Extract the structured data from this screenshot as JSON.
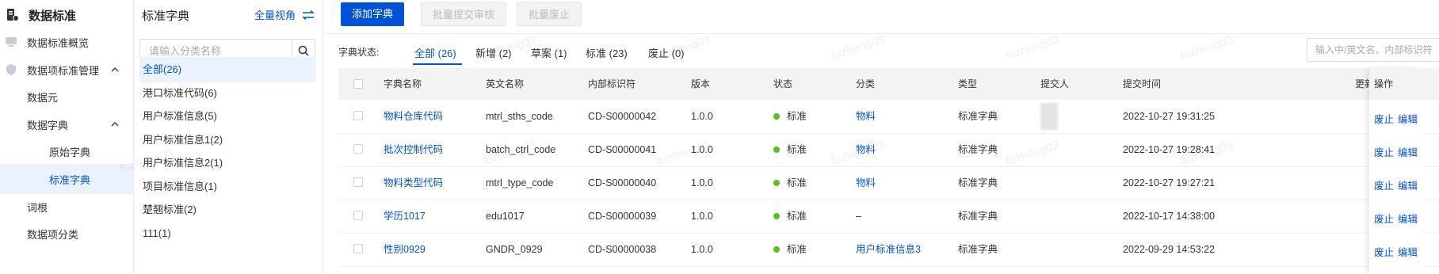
{
  "nav": {
    "title": "数据标准",
    "items": [
      {
        "label": "数据标准概览",
        "icon": "monitor-icon"
      },
      {
        "label": "数据项标准管理",
        "icon": "shield-icon",
        "expanded": true
      },
      {
        "label": "数据元"
      },
      {
        "label": "数据字典",
        "expanded": true
      },
      {
        "label": "原始字典"
      },
      {
        "label": "标准字典",
        "active": true
      },
      {
        "label": "词根"
      },
      {
        "label": "数据项分类"
      }
    ]
  },
  "category": {
    "title": "标准字典",
    "view_label": "全量视角",
    "search_placeholder": "请输入分类名称",
    "items": [
      "全部(26)",
      "港口标准代码(6)",
      "用户标准信息(5)",
      "用户标准信息1(2)",
      "用户标准信息2(1)",
      "项目标准信息(1)",
      "楚翘标准(2)",
      "111(1)"
    ]
  },
  "toolbar": {
    "add": "添加字典",
    "batch_submit": "批量提交审核",
    "batch_abolish": "批量废止"
  },
  "filter": {
    "label": "字典状态:",
    "tabs": [
      "全部 (26)",
      "新增 (2)",
      "草案 (1)",
      "标准 (23)",
      "废止 (0)"
    ],
    "active_tab": 0,
    "search_placeholder": "输入中/英文名、内部标识符"
  },
  "table": {
    "headers": [
      "字典名称",
      "英文名称",
      "内部标识符",
      "版本",
      "状态",
      "分类",
      "类型",
      "提交人",
      "提交时间",
      "更新人",
      "操作"
    ],
    "rows": [
      {
        "name": "物料仓库代码",
        "en": "mtrl_sths_code",
        "id": "CD-S00000042",
        "ver": "1.0.0",
        "status": "标准",
        "cat": "物料",
        "type": "标准字典",
        "time": "2022-10-27 19:31:25"
      },
      {
        "name": "批次控制代码",
        "en": "batch_ctrl_code",
        "id": "CD-S00000041",
        "ver": "1.0.0",
        "status": "标准",
        "cat": "物料",
        "type": "标准字典",
        "time": "2022-10-27 19:28:41"
      },
      {
        "name": "物料类型代码",
        "en": "mtrl_type_code",
        "id": "CD-S00000040",
        "ver": "1.0.0",
        "status": "标准",
        "cat": "物料",
        "type": "标准字典",
        "time": "2022-10-27 19:27:21"
      },
      {
        "name": "学历1017",
        "en": "edu1017",
        "id": "CD-S00000039",
        "ver": "1.0.0",
        "status": "标准",
        "cat": "–",
        "type": "标准字典",
        "time": "2022-10-17 14:38:00"
      },
      {
        "name": "性别0929",
        "en": "GNDR_0929",
        "id": "CD-S00000038",
        "ver": "1.0.0",
        "status": "标准",
        "cat": "用户标准信息3",
        "type": "标准字典",
        "time": "2022-09-29 14:53:22"
      }
    ],
    "actions": [
      "废止",
      "编辑"
    ]
  },
  "watermark": "fuzheng03",
  "colors": {
    "primary": "#0052d9",
    "status_green": "#52c41a"
  }
}
